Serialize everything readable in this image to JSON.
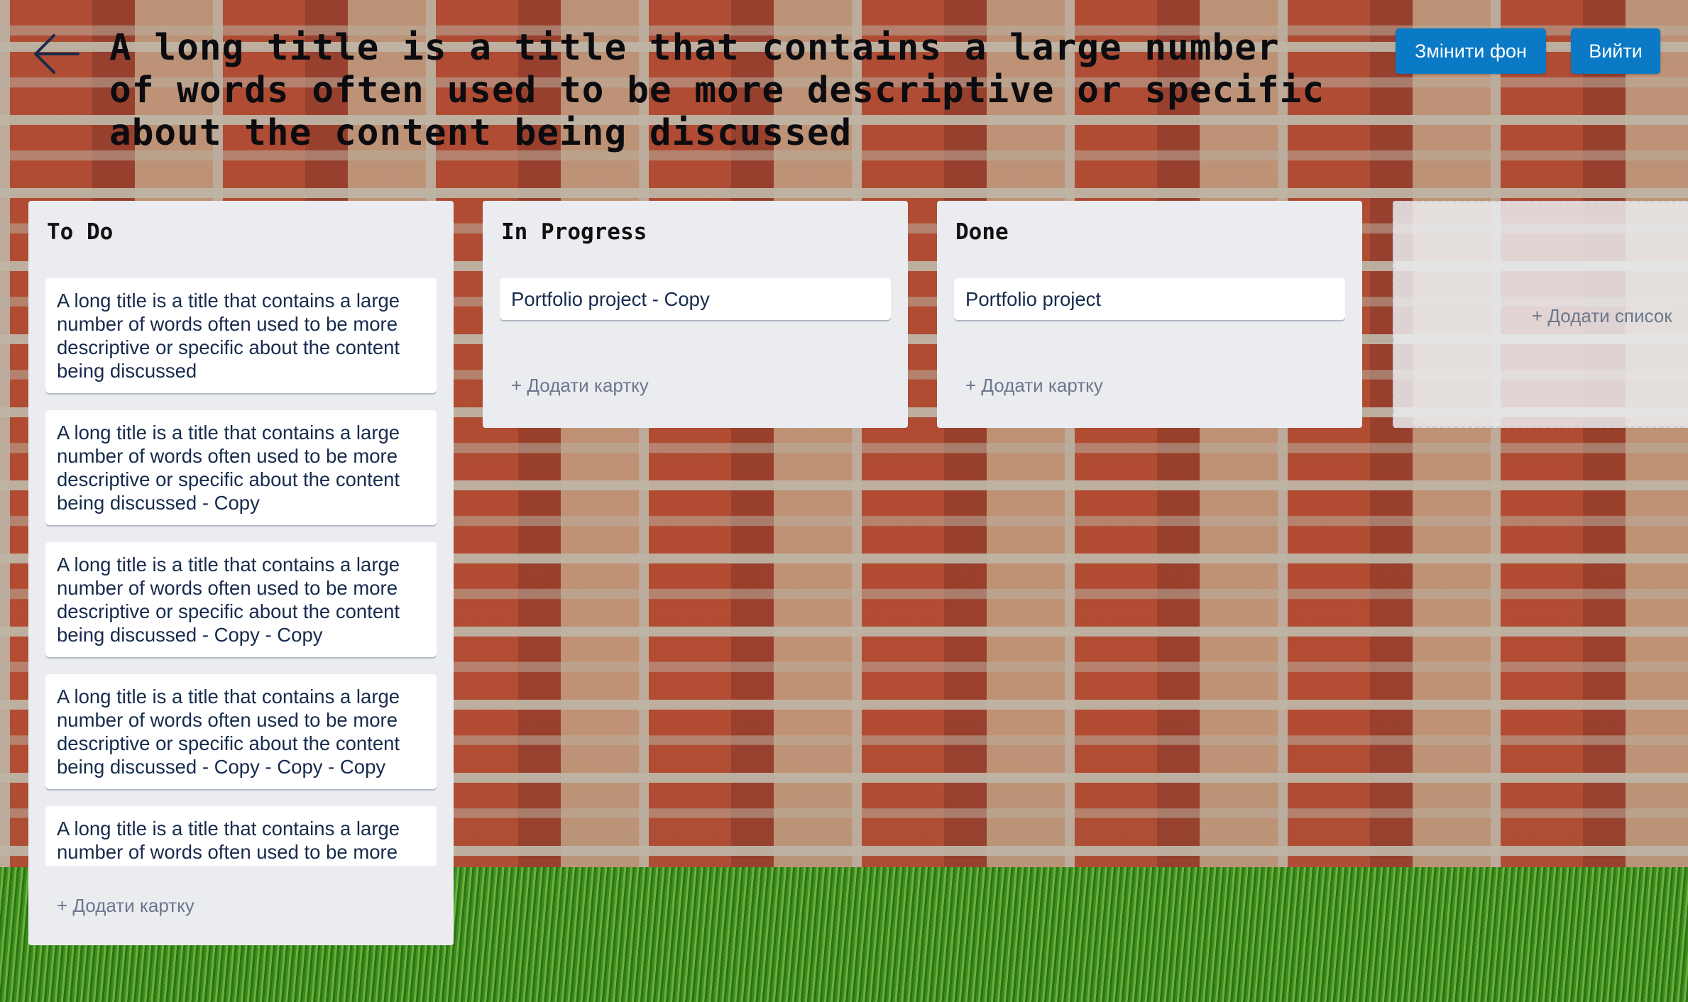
{
  "header": {
    "title": "A long title is a title that contains a large number of words often used to be more descriptive or specific about the content being discussed",
    "back_icon": "arrow-left-icon",
    "change_background_label": "Змінити фон",
    "exit_label": "Вийти",
    "button_color": "#0a79c6"
  },
  "lists": [
    {
      "title": "To Do",
      "cards": [
        "A long title is a title that contains a large number of words often used to be more descriptive or specific about the content being discussed",
        "A long title is a title that contains a large number of words often used to be more descriptive or specific about the content being discussed - Copy",
        "A long title is a title that contains a large number of words often used to be more descriptive or specific about the content being discussed - Copy - Copy",
        "A long title is a title that contains a large number of words often used to be more descriptive or specific about the content being discussed - Copy - Copy - Copy",
        "A long title is a title that contains a large number of words often used to be more descriptive or specific about the content being discussed"
      ],
      "add_card_label": "+ Додати картку"
    },
    {
      "title": "In Progress",
      "cards": [
        "Portfolio project - Copy"
      ],
      "add_card_label": "+ Додати картку"
    },
    {
      "title": "Done",
      "cards": [
        "Portfolio project"
      ],
      "add_card_label": "+ Додати картку"
    }
  ],
  "add_list_label": "+ Додати список"
}
